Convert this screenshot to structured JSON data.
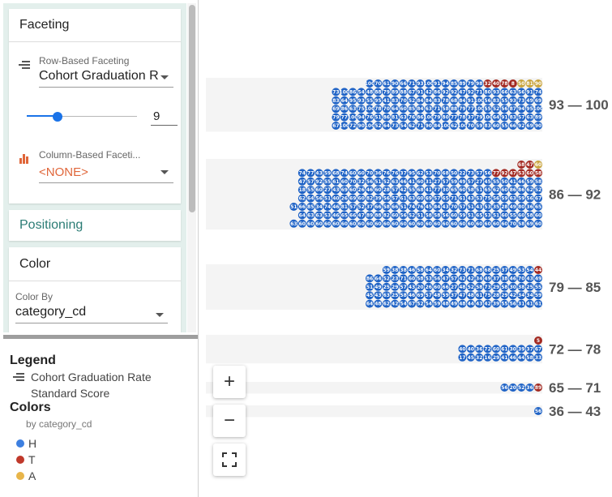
{
  "controls": {
    "faceting": {
      "title": "Faceting",
      "row_label": "Row-Based Faceting",
      "row_value": "Cohort Graduation R",
      "slider_value": "9",
      "slider_fraction": 0.28,
      "column_label": "Column-Based Faceti...",
      "column_value": "<NONE>",
      "row_icon": "rows-icon",
      "column_icon": "bar-chart-icon"
    },
    "positioning": {
      "title": "Positioning"
    },
    "color": {
      "title": "Color",
      "label": "Color By",
      "value": "category_cd"
    }
  },
  "legend": {
    "title": "Legend",
    "field_line1": "Cohort Graduation Rate",
    "field_line2": "Standard Score",
    "colors_title": "Colors",
    "colors_sub": "by category_cd",
    "items": [
      {
        "label": "H",
        "color": "#3d7fe0"
      },
      {
        "label": "T",
        "color": "#c0392b"
      },
      {
        "label": "A",
        "color": "#e8b54a"
      }
    ]
  },
  "zoom": {
    "in_label": "+",
    "out_label": "−",
    "fit_icon": "fit-screen-icon"
  },
  "colors": {
    "H": "#1f63c6",
    "T": "#a32a22",
    "A": "#c9a43c",
    "band": "#f4f4f4"
  },
  "chart_data": {
    "type": "table",
    "facets": [
      {
        "label": "93 — 100",
        "rows": [
          {
            "values": [
              "100",
              "70",
              "61",
              "90",
              "66",
              "71",
              "93",
              "100",
              "91",
              "94",
              "85",
              "89",
              "79",
              "98",
              "32",
              "40",
              "78",
              "8",
              "50",
              "81",
              "90"
            ],
            "cats": [
              "H",
              "H",
              "H",
              "H",
              "H",
              "H",
              "H",
              "H",
              "H",
              "H",
              "H",
              "H",
              "H",
              "H",
              "T",
              "T",
              "T",
              "T",
              "A",
              "A",
              "A"
            ]
          },
          {
            "values": [
              "73",
              "100",
              "86",
              "54",
              "48",
              "88",
              "79",
              "89",
              "88",
              "67",
              "91",
              "42",
              "86",
              "92",
              "92",
              "47",
              "92",
              "71",
              "80",
              "93",
              "66",
              "63",
              "56",
              "91",
              "74"
            ]
          },
          {
            "values": [
              "83",
              "64",
              "95",
              "93",
              "55",
              "95",
              "41",
              "83",
              "70",
              "52",
              "84",
              "84",
              "83",
              "78",
              "68",
              "84",
              "91",
              "100",
              "56",
              "83",
              "55",
              "93",
              "73",
              "49",
              "69"
            ]
          },
          {
            "values": [
              "69",
              "86",
              "63",
              "75",
              "100",
              "78",
              "70",
              "64",
              "60",
              "85",
              "84",
              "63",
              "71",
              "58",
              "88",
              "79",
              "77",
              "100",
              "55",
              "52",
              "56",
              "87",
              "94",
              "95",
              "100"
            ]
          },
          {
            "values": [
              "79",
              "77",
              "100",
              "94",
              "76",
              "51",
              "86",
              "81",
              "63",
              "76",
              "86",
              "100",
              "79",
              "80",
              "77",
              "78",
              "37",
              "79",
              "100",
              "64",
              "91",
              "83",
              "57",
              "63",
              "89"
            ]
          },
          {
            "values": [
              "67",
              "100",
              "72",
              "90",
              "100",
              "52",
              "64",
              "73",
              "54",
              "62",
              "71",
              "90",
              "84",
              "100",
              "62",
              "100",
              "70",
              "59",
              "83",
              "60",
              "55",
              "66",
              "92",
              "69",
              "90"
            ]
          }
        ]
      },
      {
        "label": "86 — 92",
        "rows": [
          {
            "values": [
              "68",
              "47",
              "60"
            ],
            "cats": [
              "T",
              "T",
              "A"
            ]
          },
          {
            "values": [
              "74",
              "77",
              "43",
              "59",
              "68",
              "74",
              "60",
              "60",
              "70",
              "36",
              "76",
              "76",
              "37",
              "95",
              "62",
              "53",
              "70",
              "68",
              "50",
              "22",
              "73",
              "57",
              "56",
              "77",
              "92",
              "47",
              "53",
              "60",
              "58"
            ],
            "cats": [
              "H",
              "H",
              "H",
              "H",
              "H",
              "H",
              "H",
              "H",
              "H",
              "H",
              "H",
              "H",
              "H",
              "H",
              "H",
              "H",
              "H",
              "H",
              "H",
              "H",
              "H",
              "H",
              "H",
              "T",
              "T",
              "T",
              "T",
              "T",
              "T"
            ]
          },
          {
            "values": [
              "47",
              "57",
              "92",
              "55",
              "61",
              "60",
              "70",
              "32",
              "56",
              "51",
              "52",
              "63",
              "46",
              "41",
              "60",
              "31",
              "27",
              "57",
              "59",
              "49",
              "57",
              "27",
              "45",
              "55",
              "50",
              "41",
              "46",
              "59",
              "58"
            ]
          },
          {
            "values": [
              "18",
              "55",
              "60",
              "27",
              "43",
              "69",
              "60",
              "26",
              "46",
              "60",
              "28",
              "57",
              "42",
              "55",
              "68",
              "41",
              "77",
              "30",
              "65",
              "60",
              "58",
              "51",
              "65",
              "62",
              "60",
              "86",
              "86",
              "62",
              "52"
            ]
          },
          {
            "values": [
              "62",
              "64",
              "56",
              "51",
              "40",
              "26",
              "69",
              "60",
              "82",
              "39",
              "56",
              "57",
              "61",
              "63",
              "60",
              "69",
              "57",
              "65",
              "71",
              "61",
              "43",
              "53",
              "75",
              "56",
              "59",
              "63",
              "59",
              "56",
              "67"
            ]
          },
          {
            "values": [
              "51",
              "66",
              "85",
              "34",
              "74",
              "46",
              "81",
              "57",
              "52",
              "37",
              "66",
              "58",
              "66",
              "51",
              "74",
              "76",
              "45",
              "84",
              "43",
              "70",
              "57",
              "51",
              "43",
              "53",
              "35",
              "28",
              "49",
              "80",
              "36",
              "65"
            ]
          },
          {
            "values": [
              "64",
              "63",
              "63",
              "53",
              "46",
              "65",
              "66",
              "47",
              "89",
              "88",
              "82",
              "60",
              "56",
              "52",
              "51",
              "58",
              "58",
              "56",
              "60",
              "59",
              "51",
              "65",
              "53",
              "51",
              "60",
              "55",
              "60",
              "58",
              "60"
            ]
          },
          {
            "values": [
              "63",
              "60",
              "60",
              "60",
              "60",
              "60",
              "60",
              "60",
              "60",
              "60",
              "60",
              "60",
              "60",
              "60",
              "60",
              "60",
              "60",
              "60",
              "60",
              "60",
              "60",
              "60",
              "60",
              "60",
              "60",
              "60",
              "70",
              "58",
              "69",
              "60"
            ]
          }
        ]
      },
      {
        "label": "79 — 85",
        "rows": [
          {
            "values": [
              "59",
              "38",
              "38",
              "46",
              "58",
              "64",
              "60",
              "34",
              "32",
              "73",
              "71",
              "68",
              "68",
              "25",
              "37",
              "49",
              "53",
              "54",
              "44"
            ],
            "cats": [
              "H",
              "H",
              "H",
              "H",
              "H",
              "H",
              "H",
              "H",
              "H",
              "H",
              "H",
              "H",
              "H",
              "H",
              "H",
              "H",
              "H",
              "H",
              "T"
            ]
          },
          {
            "values": [
              "86",
              "64",
              "52",
              "23",
              "71",
              "60",
              "58",
              "53",
              "56",
              "47",
              "57",
              "42",
              "42",
              "34",
              "49",
              "37",
              "38",
              "46",
              "70",
              "43",
              "49"
            ]
          },
          {
            "values": [
              "51",
              "49",
              "25",
              "29",
              "57",
              "43",
              "20",
              "26",
              "60",
              "66",
              "27",
              "48",
              "52",
              "58",
              "73",
              "29",
              "58",
              "30",
              "38",
              "25",
              "55"
            ]
          },
          {
            "values": [
              "45",
              "43",
              "63",
              "25",
              "58",
              "46",
              "69",
              "57",
              "48",
              "59",
              "37",
              "47",
              "48",
              "61",
              "75",
              "28",
              "29",
              "42",
              "34",
              "34",
              "59"
            ]
          },
          {
            "values": [
              "64",
              "48",
              "62",
              "42",
              "54",
              "67",
              "52",
              "54",
              "59",
              "48",
              "49",
              "48",
              "44",
              "43",
              "42",
              "39",
              "55",
              "56",
              "31",
              "41",
              "61"
            ]
          }
        ]
      },
      {
        "label": "72 — 78",
        "rows": [
          {
            "values": [
              "5"
            ],
            "cats": [
              "T"
            ]
          },
          {
            "values": [
              "40",
              "40",
              "36",
              "72",
              "60",
              "61",
              "30",
              "39",
              "37",
              "67"
            ]
          },
          {
            "values": [
              "17",
              "45",
              "32",
              "16",
              "29",
              "41",
              "46",
              "44",
              "58",
              "33"
            ]
          }
        ]
      },
      {
        "label": "65 — 71",
        "rows": [
          {
            "values": [
              "56",
              "20",
              "52",
              "36",
              "89"
            ],
            "cats": [
              "H",
              "H",
              "H",
              "H",
              "T"
            ]
          }
        ]
      },
      {
        "label": "36 — 43",
        "rows": [
          {
            "values": [
              "56"
            ]
          }
        ]
      }
    ]
  }
}
